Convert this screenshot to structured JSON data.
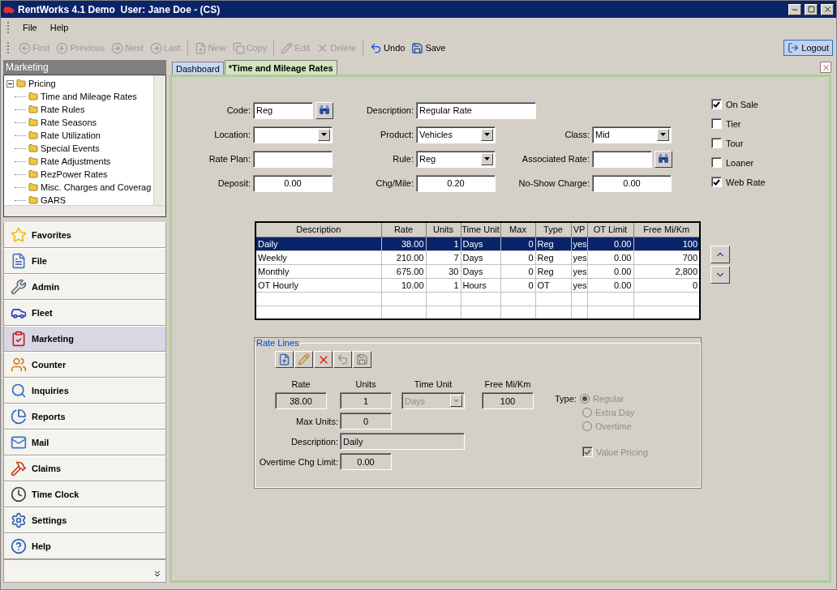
{
  "window": {
    "title": "RentWorks 4.1 Demo  User: Jane Doe - (CS)"
  },
  "menu": [
    {
      "label": "File"
    },
    {
      "label": "Help"
    }
  ],
  "toolbar": [
    {
      "label": "First",
      "disabled": true
    },
    {
      "label": "Previous",
      "disabled": true
    },
    {
      "label": "Next",
      "disabled": true
    },
    {
      "label": "Last",
      "disabled": true
    },
    {
      "label": "New",
      "disabled": true
    },
    {
      "label": "Copy",
      "disabled": true
    },
    {
      "label": "Edit",
      "disabled": true
    },
    {
      "label": "Delete",
      "disabled": true
    },
    {
      "label": "Undo",
      "disabled": false
    },
    {
      "label": "Save",
      "disabled": false
    }
  ],
  "logout": "Logout",
  "sidebar": {
    "title": "Marketing",
    "tree": [
      {
        "label": "Pricing",
        "expanded": true,
        "children": [
          {
            "label": "Time and Mileage Rates"
          },
          {
            "label": "Rate Rules"
          },
          {
            "label": "Rate Seasons"
          },
          {
            "label": "Rate Utilization"
          },
          {
            "label": "Special Events"
          },
          {
            "label": "Rate Adjustments"
          },
          {
            "label": "RezPower Rates"
          },
          {
            "label": "Misc. Charges and Coverag"
          },
          {
            "label": "GARS"
          }
        ]
      }
    ],
    "nav": [
      {
        "label": "Favorites",
        "selected": false
      },
      {
        "label": "File",
        "selected": false
      },
      {
        "label": "Admin",
        "selected": false
      },
      {
        "label": "Fleet",
        "selected": false
      },
      {
        "label": "Marketing",
        "selected": true
      },
      {
        "label": "Counter",
        "selected": false
      },
      {
        "label": "Inquiries",
        "selected": false
      },
      {
        "label": "Reports",
        "selected": false
      },
      {
        "label": "Mail",
        "selected": false
      },
      {
        "label": "Claims",
        "selected": false
      },
      {
        "label": "Time Clock",
        "selected": false
      },
      {
        "label": "Settings",
        "selected": false
      },
      {
        "label": "Help",
        "selected": false
      }
    ]
  },
  "tabs": [
    {
      "label": "Dashboard",
      "selected": false
    },
    {
      "label": "*Time and Mileage Rates",
      "selected": true
    }
  ],
  "form": {
    "rows": [
      [
        {
          "label": "Code:",
          "value": "Reg",
          "kind": "lookup"
        },
        {
          "label": "Description:",
          "value": "Regular Rate",
          "kind": "wide"
        }
      ],
      [
        {
          "label": "Location:",
          "kind": "select"
        },
        {
          "label": "Product:",
          "value": "Vehicles",
          "kind": "select"
        },
        {
          "label": "Class:",
          "value": "Mid",
          "kind": "select"
        }
      ],
      [
        {
          "label": "Rate Plan:",
          "kind": "text"
        },
        {
          "label": "Rule:",
          "value": "Reg",
          "kind": "select"
        },
        {
          "label": "Associated Rate:",
          "kind": "lookup"
        }
      ],
      [
        {
          "label": "Deposit:",
          "value": "0.00",
          "kind": "number"
        },
        {
          "label": "Chg/Mile:",
          "value": "0.20",
          "kind": "number"
        },
        {
          "label": "No-Show Charge:",
          "value": "0.00",
          "kind": "number"
        }
      ]
    ],
    "checkboxes": [
      {
        "label": "On Sale",
        "checked": true
      },
      {
        "label": "Tier",
        "checked": false
      },
      {
        "label": "Tour",
        "checked": false
      },
      {
        "label": "Loaner",
        "checked": false
      },
      {
        "label": "Web Rate",
        "checked": true
      }
    ]
  },
  "table": {
    "columns": [
      "Description",
      "Rate",
      "Units",
      "Time Unit",
      "Max",
      "Type",
      "VP",
      "OT Limit",
      "Free Mi/Km"
    ],
    "rows": [
      {
        "cells": [
          "Daily",
          "38.00",
          "1",
          "Days",
          "0",
          "Reg",
          "yes",
          "0.00",
          "100"
        ],
        "selected": true
      },
      {
        "cells": [
          "Weekly",
          "210.00",
          "7",
          "Days",
          "0",
          "Reg",
          "yes",
          "0.00",
          "700"
        ],
        "selected": false
      },
      {
        "cells": [
          "Monthly",
          "675.00",
          "30",
          "Days",
          "0",
          "Reg",
          "yes",
          "0.00",
          "2,800"
        ],
        "selected": false
      },
      {
        "cells": [
          "OT Hourly",
          "10.00",
          "1",
          "Hours",
          "0",
          "OT",
          "yes",
          "0.00",
          "0"
        ],
        "selected": false
      }
    ]
  },
  "rate_lines": {
    "title": "Rate Lines",
    "top_fields": [
      {
        "label": "Rate",
        "value": "38.00",
        "kind": "box",
        "disabled": false
      },
      {
        "label": "Units",
        "value": "1",
        "kind": "box",
        "disabled": false
      },
      {
        "label": "Time Unit",
        "value": "Days",
        "kind": "select",
        "disabled": true
      },
      {
        "label": "Free Mi/Km",
        "value": "100",
        "kind": "box",
        "disabled": false
      }
    ],
    "side_fields": [
      {
        "label": "Max Units:",
        "value": "0",
        "kind": "short"
      },
      {
        "label": "Description:",
        "value": "Daily",
        "kind": "long"
      },
      {
        "label": "Overtime Chg Limit:",
        "value": "0.00",
        "kind": "short"
      }
    ],
    "type_label": "Type:",
    "types": [
      {
        "label": "Regular",
        "selected": true,
        "disabled": true
      },
      {
        "label": "Extra Day",
        "selected": false,
        "disabled": true
      },
      {
        "label": "Overtime",
        "selected": false,
        "disabled": true
      }
    ],
    "value_pricing": {
      "label": "Value Pricing",
      "checked": true,
      "disabled": true
    }
  }
}
